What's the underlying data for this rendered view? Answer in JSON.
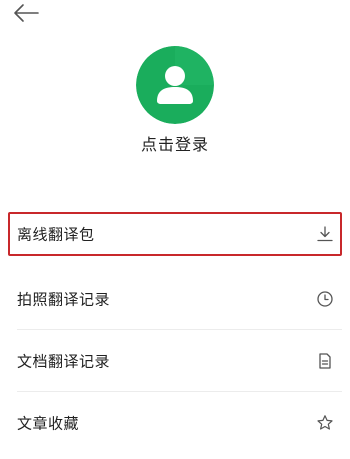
{
  "header": {
    "back_icon": "arrow-left-icon"
  },
  "profile": {
    "avatar_icon": "user-avatar-icon",
    "avatar_color": "#1aad5c",
    "login_label": "点击登录"
  },
  "menu": {
    "items": [
      {
        "label": "离线翻译包",
        "icon": "download-icon",
        "highlighted": true
      },
      {
        "label": "拍照翻译记录",
        "icon": "clock-icon",
        "highlighted": false
      },
      {
        "label": "文档翻译记录",
        "icon": "document-icon",
        "highlighted": false
      },
      {
        "label": "文章收藏",
        "icon": "star-icon",
        "highlighted": false
      }
    ]
  },
  "colors": {
    "highlight_border": "#c8282b",
    "divider": "#ececec",
    "icon_gray": "#555555"
  }
}
